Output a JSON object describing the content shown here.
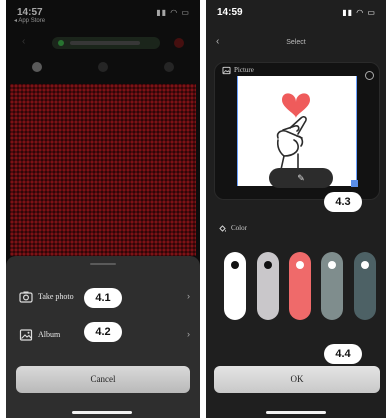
{
  "left": {
    "status": {
      "time": "14:57",
      "back_app": "◂ App Store"
    },
    "sheet": {
      "options": [
        {
          "label": "Take photo",
          "badge": "4.1"
        },
        {
          "label": "Album",
          "badge": "4.2"
        }
      ],
      "cancel_label": "Cancel"
    },
    "colors": {
      "led_on": "#c21c22",
      "led_off": "#4a0a0d"
    }
  },
  "right": {
    "status": {
      "time": "14:59"
    },
    "title": "Select",
    "picture": {
      "label": "Picture",
      "badge": "4.3"
    },
    "color": {
      "label": "Color",
      "swatches": [
        "#ffffff",
        "#c9c7ca",
        "#ef6a6a",
        "#7f8d8d",
        "#4d6165"
      ]
    },
    "ok_badge": "4.4",
    "ok_label": "OK"
  }
}
